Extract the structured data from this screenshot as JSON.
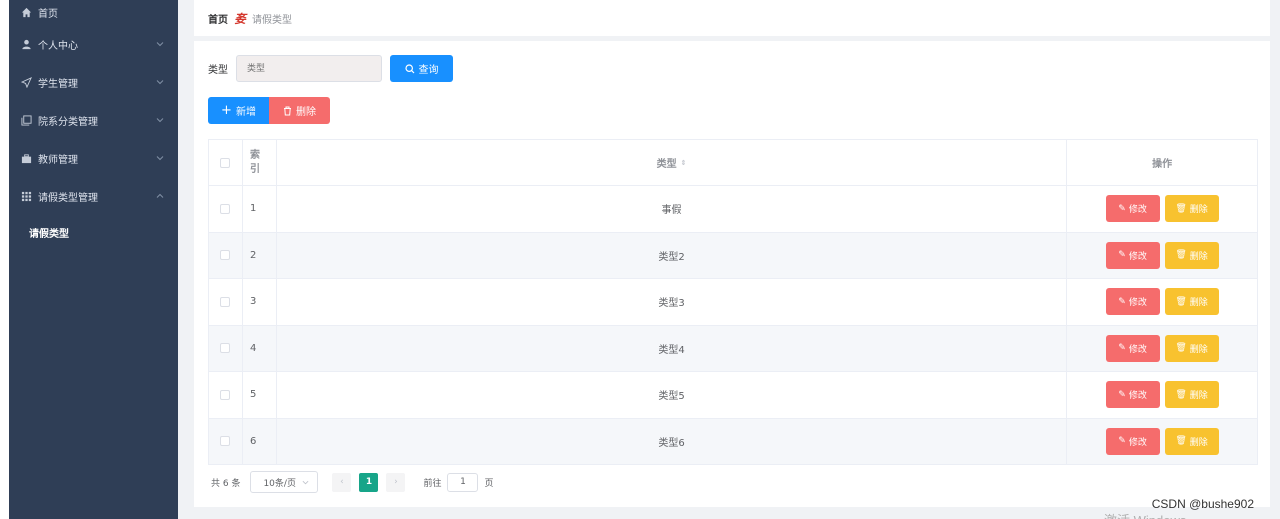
{
  "sidebar": {
    "items": [
      {
        "label": "首页",
        "icon": "home-icon"
      },
      {
        "label": "个人中心",
        "icon": "user-icon"
      },
      {
        "label": "学生管理",
        "icon": "send-icon"
      },
      {
        "label": "院系分类管理",
        "icon": "copy-icon"
      },
      {
        "label": "教师管理",
        "icon": "briefcase-icon"
      },
      {
        "label": "请假类型管理",
        "icon": "grid-icon"
      }
    ],
    "subitem": "请假类型"
  },
  "breadcrumb": {
    "home": "首页",
    "separator": "㚣",
    "current": "请假类型"
  },
  "search": {
    "label": "类型",
    "placeholder": "类型",
    "button": "查询"
  },
  "actions": {
    "add": "新增",
    "delete": "删除"
  },
  "table": {
    "headers": {
      "index": "索\n引",
      "type": "类型",
      "operation": "操作"
    },
    "rows": [
      {
        "index": "1",
        "type": "事假"
      },
      {
        "index": "2",
        "type": "类型2"
      },
      {
        "index": "3",
        "type": "类型3"
      },
      {
        "index": "4",
        "type": "类型4"
      },
      {
        "index": "5",
        "type": "类型5"
      },
      {
        "index": "6",
        "type": "类型6"
      }
    ],
    "edit_label": "修改",
    "delete_label": "删除"
  },
  "pagination": {
    "total": "共 6 条",
    "page_size": "10条/页",
    "current_page": "1",
    "goto_prefix": "前往",
    "goto_value": "1",
    "goto_suffix": "页"
  },
  "watermark": "CSDN @bushe902",
  "windows_text": "激活 Windows",
  "colors": {
    "sidebar_bg": "#2f3e56",
    "primary": "#1890ff",
    "danger": "#f56c6c",
    "warning": "#f8c22f",
    "page_active": "#17a589"
  }
}
